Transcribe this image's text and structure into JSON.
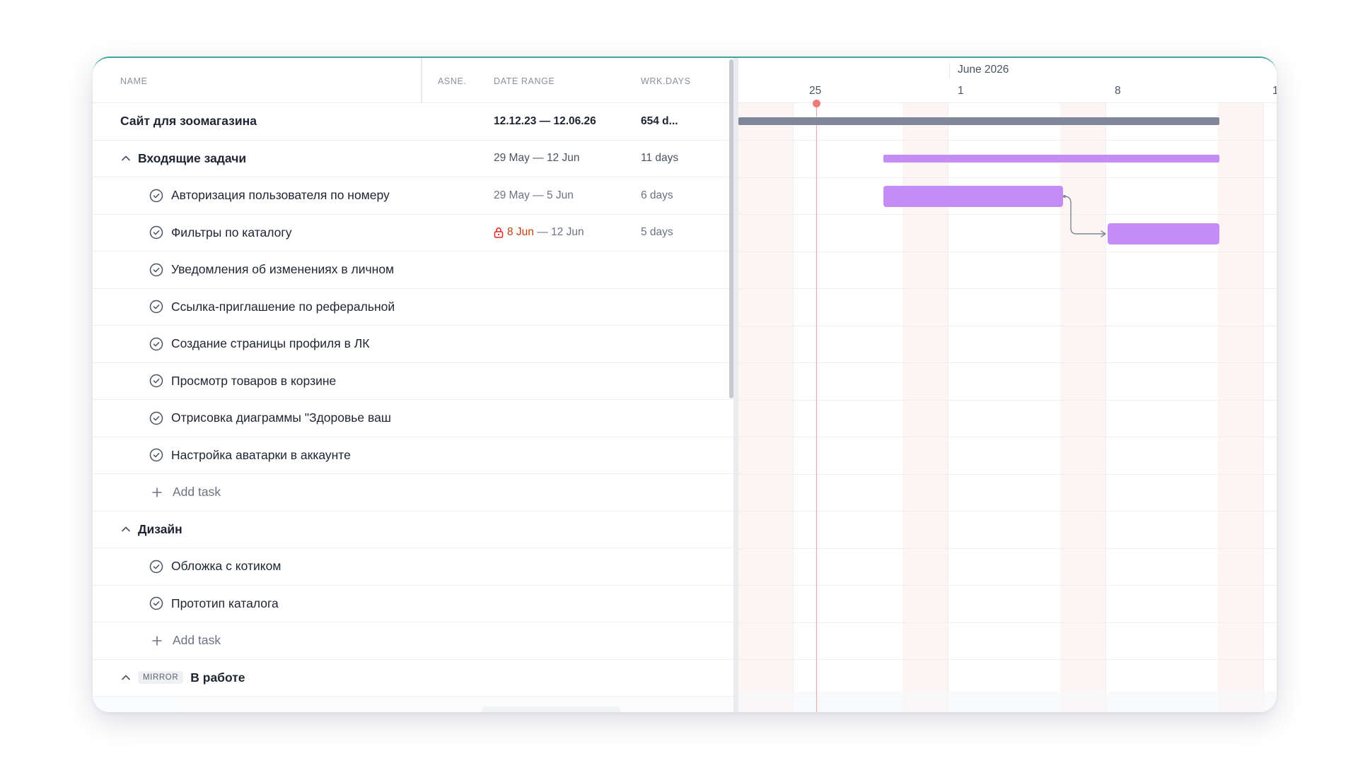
{
  "columns": {
    "name": "NAME",
    "assignee": "ASNE.",
    "date_range": "DATE RANGE",
    "work_days": "WRK.DAYS"
  },
  "project": {
    "name": "Сайт для зоомагазина",
    "date_range": "12.12.23 — 12.06.26",
    "work_days": "654 d..."
  },
  "groups": [
    {
      "name": "Входящие задачи",
      "date_range": "29 May — 12 Jun",
      "work_days": "11 days",
      "tasks": [
        {
          "name": "Авторизация пользователя по номеру",
          "date_range": "29 May — 5 Jun",
          "work_days": "6 days"
        },
        {
          "name": "Фильтры по каталогу",
          "date_start": "8 Jun",
          "date_sep": " — ",
          "date_end": "12 Jun",
          "work_days": "5 days"
        },
        {
          "name": "Уведомления об изменениях в личном"
        },
        {
          "name": "Ссылка-приглашение по реферальной"
        },
        {
          "name": "Создание страницы профиля в ЛК"
        },
        {
          "name": "Просмотр товаров в корзине"
        },
        {
          "name": "Отрисовка диаграммы \"Здоровье ваш"
        },
        {
          "name": "Настройка аватарки в аккаунте"
        }
      ],
      "add_label": "Add task"
    },
    {
      "name": "Дизайн",
      "tasks": [
        {
          "name": "Обложка с котиком"
        },
        {
          "name": "Прототип каталога"
        }
      ],
      "add_label": "Add task"
    },
    {
      "badge": "MIRROR",
      "name": "В работе"
    }
  ],
  "timeline": {
    "month": "June 2026",
    "days": [
      "25",
      "1",
      "8",
      "1"
    ]
  },
  "colors": {
    "accent_top": "#3fa69a",
    "summary_bar": "#7e8698",
    "task_bar": "#c58cf5",
    "today_marker": "#f07b7b",
    "locked_date": "#c2410c"
  }
}
